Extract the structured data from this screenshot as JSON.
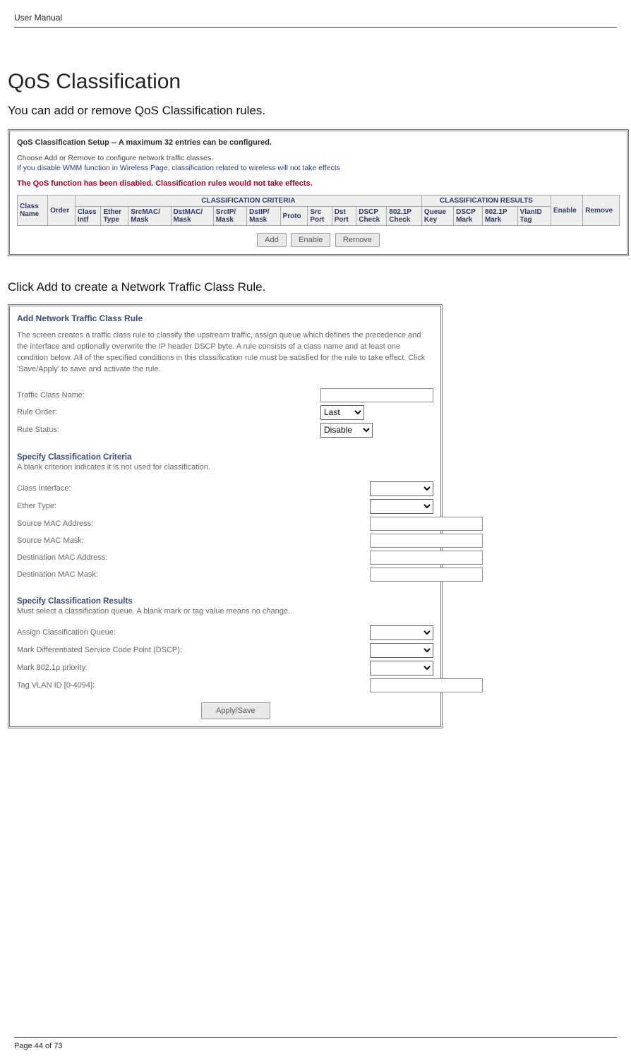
{
  "header": {
    "label": "User Manual"
  },
  "title": "QoS Classification",
  "intro": "You can add or remove QoS Classification rules.",
  "panel1": {
    "heading": "QoS Classification Setup -- A maximum 32 entries can be configured.",
    "line1": "Choose Add or Remove to configure network traffic classes.",
    "line2": "If you disable WMM function in Wireless Page, classification related to wireless will not take effects",
    "warning": "The QoS function has been disabled. Classification rules would not take effects.",
    "table": {
      "group_criteria": "CLASSIFICATION CRITERIA",
      "group_results": "CLASSIFICATION RESULTS",
      "cols": [
        "Class Name",
        "Order",
        "Class Intf",
        "Ether Type",
        "SrcMAC/ Mask",
        "DstMAC/ Mask",
        "SrcIP/ Mask",
        "DstIP/ Mask",
        "Proto",
        "Src Port",
        "Dst Port",
        "DSCP Check",
        "802.1P Check",
        "Queue Key",
        "DSCP Mark",
        "802.1P Mark",
        "VlanID Tag",
        "Enable",
        "Remove"
      ]
    },
    "buttons": {
      "add": "Add",
      "enable": "Enable",
      "remove": "Remove"
    }
  },
  "instr": "Click Add to create a Network Traffic Class Rule.",
  "panel2": {
    "title": "Add Network Traffic Class Rule",
    "desc": "The screen creates a traffic class rule to classify the upstream traffic, assign queue which defines the precedence and the interface and optionally overwrite the IP header DSCP byte. A rule consists of a class name and at least one condition below. All of the specified conditions in this classification rule must be satisfied for the rule to take effect. Click 'Save/Apply' to save and activate the rule.",
    "rows": {
      "traffic_class_name": "Traffic Class Name:",
      "rule_order": "Rule Order:",
      "rule_status": "Rule Status:"
    },
    "order_val": "Last",
    "status_val": "Disable",
    "criteria": {
      "heading": "Specify Classification Criteria",
      "sub": "A blank criterion indicates it is not used for classification.",
      "class_interface": "Class Interface:",
      "ether_type": "Ether Type:",
      "src_mac": "Source MAC Address:",
      "src_mask": "Source MAC Mask:",
      "dst_mac": "Destination MAC Address:",
      "dst_mask": "Destination MAC Mask:"
    },
    "results": {
      "heading": "Specify Classification Results",
      "sub": "Must select a classification queue. A blank mark or tag value means no change.",
      "assign_queue": "Assign Classification Queue:",
      "mark_dscp": "Mark Differentiated Service Code Point (DSCP):",
      "mark_8021p": "Mark 802.1p priority:",
      "tag_vlan": "Tag VLAN ID [0-4094]:"
    },
    "apply": "Apply/Save"
  },
  "footer": {
    "page": "Page 44 of 73"
  }
}
